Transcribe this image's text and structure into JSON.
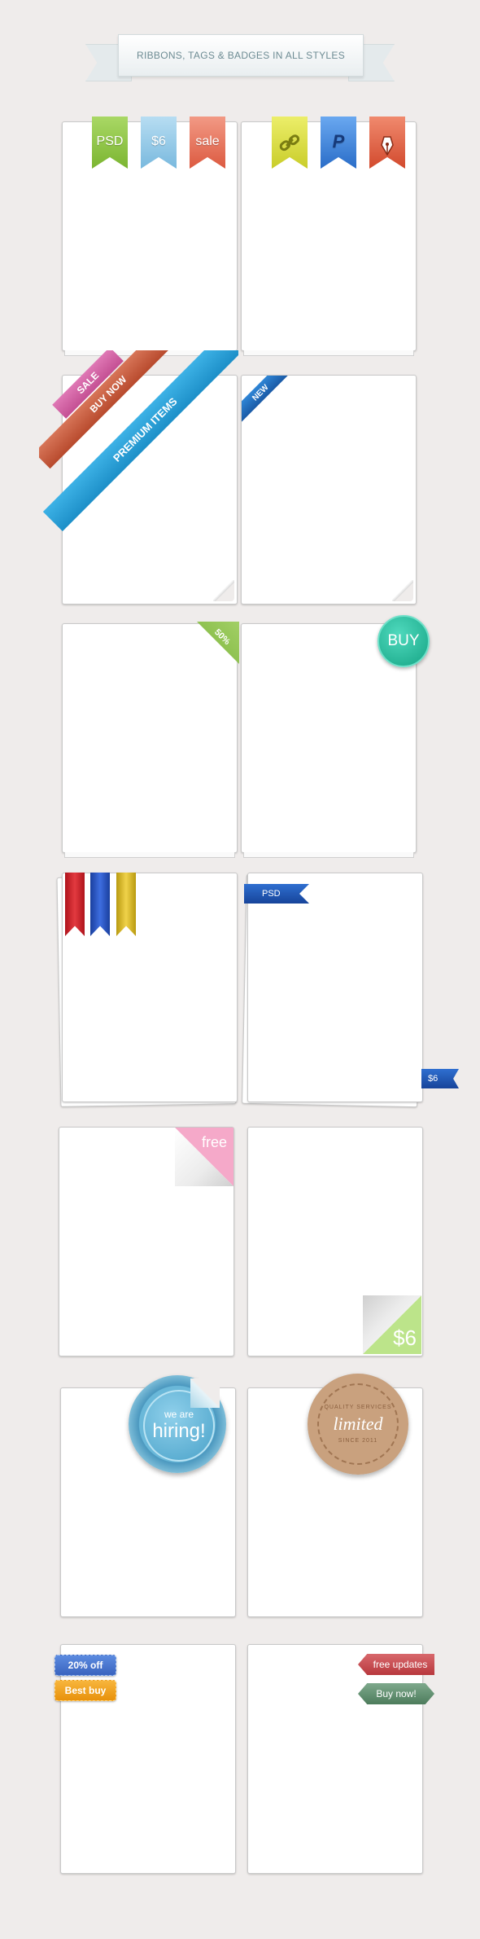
{
  "title": "RIBBONS, TAGS & BADGES IN ALL STYLES",
  "row1": {
    "left": [
      {
        "label": "PSD",
        "color": "#8cc63f"
      },
      {
        "label": "$6",
        "color": "#8fc8e8"
      },
      {
        "label": "sale",
        "color": "#e9674f"
      }
    ],
    "right_icons": [
      {
        "icon": "link-icon",
        "color": "#d7dc3a"
      },
      {
        "icon": "paypal-icon",
        "color": "#3b82d6"
      },
      {
        "icon": "pen-nib-icon",
        "color": "#e05a3c"
      }
    ]
  },
  "row2": {
    "sale": "SALE",
    "buy_now": "BUY NOW",
    "premium": "PREMIUM ITEMS",
    "new": "NEW"
  },
  "row3": {
    "percent": "50%",
    "buy": "BUY"
  },
  "row4": {
    "psd": "PSD",
    "price": "$6"
  },
  "row5": {
    "free": "free",
    "price": "$6"
  },
  "row6": {
    "we_are": "we are",
    "hiring": "hiring!",
    "quality": "QUALITY SERVICES",
    "limited": "limited",
    "since": "SINCE 2011"
  },
  "row7": {
    "off": "20% off",
    "best_buy": "Best buy",
    "free_updates": "free updates",
    "buy_now": "Buy now!"
  },
  "colors": {
    "background": "#efeceb",
    "green": "#8cc63f",
    "blue": "#27a3d9",
    "teal": "#20b59a",
    "pink": "#f4a6c8"
  }
}
